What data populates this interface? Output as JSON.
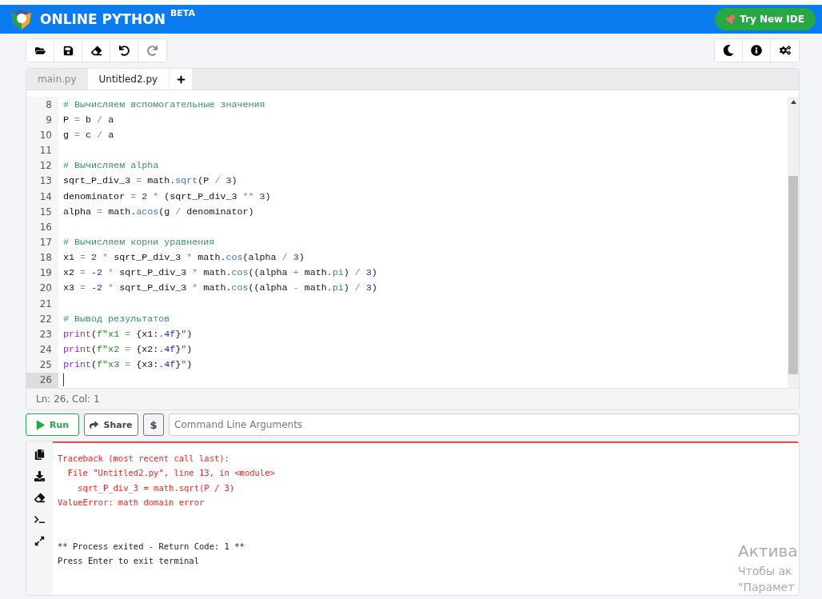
{
  "header": {
    "title": "ONLINE PYTHON",
    "badge": "BETA",
    "cta": "Try New IDE"
  },
  "toolbar_left": [
    {
      "disabled": false
    },
    {
      "disabled": false
    },
    {
      "disabled": false
    },
    {
      "disabled": false
    },
    {
      "disabled": true
    }
  ],
  "editor": {
    "tabs": [
      {
        "label": "main.py",
        "selected": false
      },
      {
        "label": "Untitled2.py",
        "selected": true
      }
    ],
    "lines": [
      {
        "number": "8",
        "active": false,
        "tokens": [
          {
            "kind": "comment",
            "text": "# Вычисляем вспомогательные значения"
          }
        ]
      },
      {
        "number": "9",
        "active": false,
        "tokens": [
          {
            "kind": "plain",
            "text": "P"
          },
          {
            "kind": "op",
            "text": " = "
          },
          {
            "kind": "plain",
            "text": "b"
          },
          {
            "kind": "op",
            "text": " / "
          },
          {
            "kind": "plain",
            "text": "a"
          }
        ]
      },
      {
        "number": "10",
        "active": false,
        "tokens": [
          {
            "kind": "plain",
            "text": "g"
          },
          {
            "kind": "op",
            "text": " = "
          },
          {
            "kind": "plain",
            "text": "c"
          },
          {
            "kind": "op",
            "text": " / "
          },
          {
            "kind": "plain",
            "text": "a"
          }
        ]
      },
      {
        "number": "11",
        "active": false
      },
      {
        "number": "12",
        "active": false,
        "tokens": [
          {
            "kind": "comment",
            "text": "# Вычисляем alpha"
          }
        ]
      },
      {
        "number": "13",
        "active": false,
        "tokens": [
          {
            "kind": "plain",
            "text": "sqrt_P_div_3"
          },
          {
            "kind": "op",
            "text": " = "
          },
          {
            "kind": "plain",
            "text": "math."
          },
          {
            "kind": "fn",
            "text": "sqrt"
          },
          {
            "kind": "plain",
            "text": "(P"
          },
          {
            "kind": "op",
            "text": " / "
          },
          {
            "kind": "num",
            "text": "3"
          },
          {
            "kind": "plain",
            "text": ")"
          }
        ]
      },
      {
        "number": "14",
        "active": false,
        "tokens": [
          {
            "kind": "plain",
            "text": "denominator"
          },
          {
            "kind": "op",
            "text": " = "
          },
          {
            "kind": "num",
            "text": "2"
          },
          {
            "kind": "op",
            "text": " * "
          },
          {
            "kind": "plain",
            "text": "(sqrt_P_div_3"
          },
          {
            "kind": "op",
            "text": " ** "
          },
          {
            "kind": "num",
            "text": "3"
          },
          {
            "kind": "plain",
            "text": ")"
          }
        ]
      },
      {
        "number": "15",
        "active": false,
        "tokens": [
          {
            "kind": "plain",
            "text": "alpha"
          },
          {
            "kind": "op",
            "text": " = "
          },
          {
            "kind": "plain",
            "text": "math."
          },
          {
            "kind": "fn",
            "text": "acos"
          },
          {
            "kind": "plain",
            "text": "(g"
          },
          {
            "kind": "op",
            "text": " / "
          },
          {
            "kind": "plain",
            "text": "denominator)"
          }
        ]
      },
      {
        "number": "16",
        "active": false
      },
      {
        "number": "17",
        "active": false,
        "tokens": [
          {
            "kind": "comment",
            "text": "# Вычисляем корни уравнения"
          }
        ]
      },
      {
        "number": "18",
        "active": false,
        "tokens": [
          {
            "kind": "plain",
            "text": "x1"
          },
          {
            "kind": "op",
            "text": " = "
          },
          {
            "kind": "num",
            "text": "2"
          },
          {
            "kind": "op",
            "text": " * "
          },
          {
            "kind": "plain",
            "text": "sqrt_P_div_3"
          },
          {
            "kind": "op",
            "text": " * "
          },
          {
            "kind": "plain",
            "text": "math."
          },
          {
            "kind": "fn",
            "text": "cos"
          },
          {
            "kind": "plain",
            "text": "(alpha"
          },
          {
            "kind": "op",
            "text": " / "
          },
          {
            "kind": "num",
            "text": "3"
          },
          {
            "kind": "plain",
            "text": ")"
          }
        ]
      },
      {
        "number": "19",
        "active": false,
        "tokens": [
          {
            "kind": "plain",
            "text": "x2"
          },
          {
            "kind": "op",
            "text": " = "
          },
          {
            "kind": "num",
            "text": "-2"
          },
          {
            "kind": "op",
            "text": " * "
          },
          {
            "kind": "plain",
            "text": "sqrt_P_div_3"
          },
          {
            "kind": "op",
            "text": " * "
          },
          {
            "kind": "plain",
            "text": "math."
          },
          {
            "kind": "fn",
            "text": "cos"
          },
          {
            "kind": "plain",
            "text": "((alpha"
          },
          {
            "kind": "op",
            "text": " + "
          },
          {
            "kind": "plain",
            "text": "math."
          },
          {
            "kind": "fn",
            "text": "pi"
          },
          {
            "kind": "plain",
            "text": ")"
          },
          {
            "kind": "op",
            "text": " / "
          },
          {
            "kind": "num",
            "text": "3"
          },
          {
            "kind": "plain",
            "text": ")"
          }
        ]
      },
      {
        "number": "20",
        "active": false,
        "tokens": [
          {
            "kind": "plain",
            "text": "x3"
          },
          {
            "kind": "op",
            "text": " = "
          },
          {
            "kind": "num",
            "text": "-2"
          },
          {
            "kind": "op",
            "text": " * "
          },
          {
            "kind": "plain",
            "text": "sqrt_P_div_3"
          },
          {
            "kind": "op",
            "text": " * "
          },
          {
            "kind": "plain",
            "text": "math."
          },
          {
            "kind": "fn",
            "text": "cos"
          },
          {
            "kind": "plain",
            "text": "((alpha"
          },
          {
            "kind": "op",
            "text": " - "
          },
          {
            "kind": "plain",
            "text": "math."
          },
          {
            "kind": "fn",
            "text": "pi"
          },
          {
            "kind": "plain",
            "text": ")"
          },
          {
            "kind": "op",
            "text": " / "
          },
          {
            "kind": "num",
            "text": "3"
          },
          {
            "kind": "plain",
            "text": ")"
          }
        ]
      },
      {
        "number": "21",
        "active": false
      },
      {
        "number": "22",
        "active": false,
        "tokens": [
          {
            "kind": "comment",
            "text": "# Вывод результатов"
          }
        ]
      },
      {
        "number": "23",
        "active": false,
        "tokens": [
          {
            "kind": "builtin",
            "text": "print"
          },
          {
            "kind": "plain",
            "text": "("
          },
          {
            "kind": "str",
            "text": "f\"x1"
          },
          {
            "kind": "op",
            "text": " = "
          },
          {
            "kind": "plain",
            "text": "{x1:"
          },
          {
            "kind": "num",
            "text": ".4f"
          },
          {
            "kind": "plain",
            "text": "}"
          },
          {
            "kind": "str",
            "text": "\""
          },
          {
            "kind": "plain",
            "text": ")"
          }
        ]
      },
      {
        "number": "24",
        "active": false,
        "tokens": [
          {
            "kind": "builtin",
            "text": "print"
          },
          {
            "kind": "plain",
            "text": "("
          },
          {
            "kind": "str",
            "text": "f\"x2"
          },
          {
            "kind": "op",
            "text": " = "
          },
          {
            "kind": "plain",
            "text": "{x2:"
          },
          {
            "kind": "num",
            "text": ".4f"
          },
          {
            "kind": "plain",
            "text": "}"
          },
          {
            "kind": "str",
            "text": "\""
          },
          {
            "kind": "plain",
            "text": ")"
          }
        ]
      },
      {
        "number": "25",
        "active": false,
        "tokens": [
          {
            "kind": "builtin",
            "text": "print"
          },
          {
            "kind": "plain",
            "text": "("
          },
          {
            "kind": "str",
            "text": "f\"x3"
          },
          {
            "kind": "op",
            "text": " = "
          },
          {
            "kind": "plain",
            "text": "{x3:"
          },
          {
            "kind": "num",
            "text": ".4f"
          },
          {
            "kind": "plain",
            "text": "}"
          },
          {
            "kind": "str",
            "text": "\""
          },
          {
            "kind": "plain",
            "text": ")"
          }
        ]
      },
      {
        "number": "26",
        "active": true
      }
    ],
    "status": "Ln: 26,  Col: 1"
  },
  "run_bar": {
    "run": "Run",
    "share": "Share",
    "dollar": "$",
    "args_placeholder": "Command Line Arguments"
  },
  "terminal": {
    "lines": [
      {
        "kind": "error",
        "text": "Traceback (most recent call last):"
      },
      {
        "kind": "error",
        "text": "  File \"Untitled2.py\", line 13, in <module>"
      },
      {
        "kind": "error",
        "text": "    sqrt_P_div_3 = math.sqrt(P / 3)"
      },
      {
        "kind": "error",
        "text": "ValueError: math domain error"
      },
      {
        "kind": "blank"
      },
      {
        "kind": "blank"
      },
      {
        "kind": "output",
        "text": "** Process exited - Return Code: 1 **"
      },
      {
        "kind": "output",
        "text": "Press Enter to exit terminal"
      }
    ]
  },
  "os_notice": [
    "Актива",
    "Чтобы ак",
    "\"Парамет"
  ]
}
